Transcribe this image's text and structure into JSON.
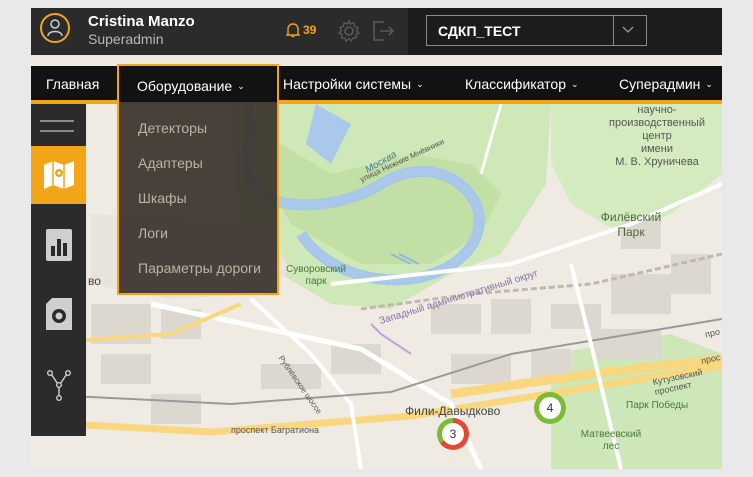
{
  "user": {
    "name": "Cristina Manzo",
    "role": "Superadmin"
  },
  "header": {
    "notification_count": "39",
    "selected_system": "СДКП_ТЕСТ"
  },
  "nav": {
    "home": "Главная",
    "equipment": "Оборудование",
    "settings": "Настройки системы",
    "classifier": "Классификатор",
    "superadmin": "Суперадмин"
  },
  "dropdown": {
    "items": [
      "Детекторы",
      "Адаптеры",
      "Шкафы",
      "Логи",
      "Параметры дороги"
    ]
  },
  "map": {
    "labels": {
      "institute": [
        "научно-",
        "производственный",
        "центр",
        "имени",
        "М. В. Хруничева"
      ],
      "filevsky": [
        "Филёвский",
        "Парк"
      ],
      "suvorov": [
        "Суворовский",
        "парк"
      ],
      "fili": "Фили-Давыдково",
      "matveevsky": [
        "Матвеевский",
        "лес"
      ],
      "pobedy": "Парк Победы",
      "kutuzovsky": "Кутузовский проспект",
      "bagrationa": "проспект Багратиона",
      "rublevskoe": "Рублёвское шоссе",
      "nizhnie": "улица Нижние Мнёвники",
      "moskva": "Москва",
      "okrug": "Западный административный округ",
      "edge_left": "во",
      "edge_right1": "про",
      "edge_right2": "прос"
    },
    "clusters": [
      {
        "count": "3",
        "color": "#e34a33"
      },
      {
        "count": "4",
        "color": "#7dbb34"
      }
    ]
  },
  "colors": {
    "accent": "#f2a516",
    "header_bg": "#2b2b2b",
    "nav_bg": "#121212"
  },
  "icons": [
    "user-icon",
    "bell-icon",
    "gear-icon",
    "logout-icon",
    "chevron-down-icon",
    "hamburger-icon",
    "map-icon",
    "chart-icon",
    "disk-icon",
    "graph-icon"
  ]
}
